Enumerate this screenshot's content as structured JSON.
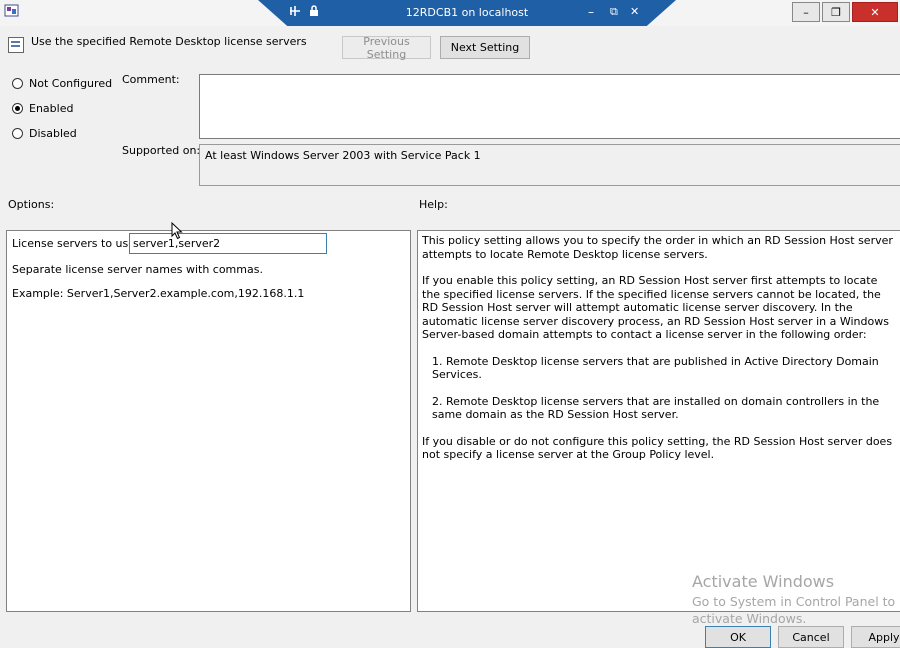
{
  "rdp_bar": {
    "title": "12RDCB1 on localhost",
    "pin_icon": "pin-icon",
    "lock_icon": "lock-icon",
    "minimize_glyph": "–",
    "restore_glyph": "⧉",
    "close_glyph": "✕"
  },
  "window": {
    "minimize_glyph": "–",
    "restore_glyph": "❐",
    "close_glyph": "✕"
  },
  "policy": {
    "title": "Use the specified Remote Desktop license servers",
    "previous_label": "Previous Setting",
    "next_label": "Next Setting"
  },
  "state": {
    "options": [
      {
        "label": "Not Configured",
        "checked": false
      },
      {
        "label": "Enabled",
        "checked": true
      },
      {
        "label": "Disabled",
        "checked": false
      }
    ]
  },
  "comment": {
    "label": "Comment:",
    "value": ""
  },
  "supported": {
    "label": "Supported on:",
    "value": "At least Windows Server 2003 with Service Pack 1"
  },
  "options_panel": {
    "heading": "Options:",
    "field_label": "License servers to use:",
    "field_value": "server1,server2",
    "note": "Separate license server names with commas.",
    "example": "Example: Server1,Server2.example.com,192.168.1.1"
  },
  "help_panel": {
    "heading": "Help:",
    "paragraphs": [
      "This policy setting allows you to specify the order in which an RD Session Host server attempts to locate Remote Desktop license servers.",
      "If you enable this policy setting, an RD Session Host server first attempts to locate the specified license servers. If the specified license servers cannot be located, the RD Session Host server will attempt automatic license server discovery. In the automatic license server discovery process, an RD Session Host server in a Windows Server-based domain attempts to contact a license server in the following order:",
      "1. Remote Desktop license servers that are published in Active Directory Domain Services.",
      "2. Remote Desktop license servers that are installed on domain controllers in the same domain as the RD Session Host server.",
      "If you disable or do not configure this policy setting, the RD Session Host server does not specify a license server at the Group Policy level."
    ]
  },
  "watermark": {
    "line1": "Activate Windows",
    "line2": "Go to System in Control Panel to",
    "line3": "activate Windows."
  },
  "footer": {
    "ok_label": "OK",
    "cancel_label": "Cancel",
    "apply_label": "Apply"
  }
}
